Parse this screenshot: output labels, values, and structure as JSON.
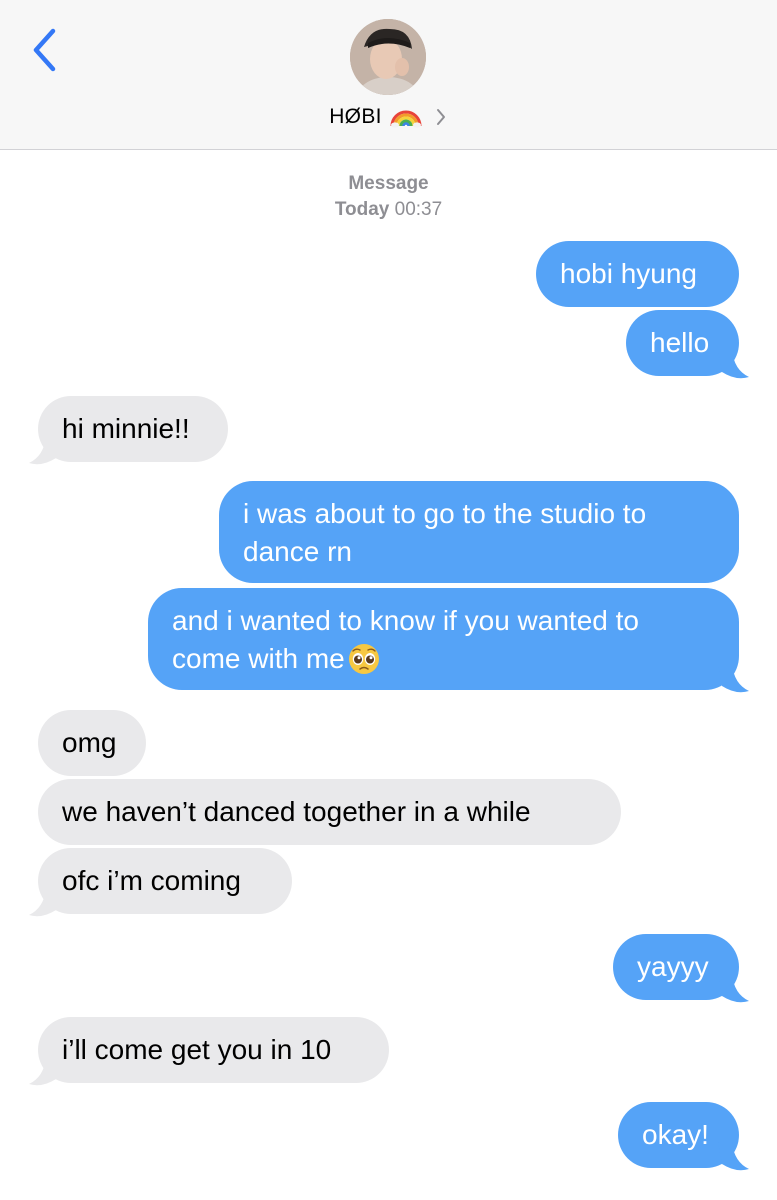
{
  "header": {
    "back_icon": "chevron-left-icon",
    "contact_name": "HØBI",
    "contact_emoji_icon": "rainbow-icon",
    "details_icon": "chevron-right-icon",
    "accent": "#3478f6"
  },
  "thread_meta": {
    "service": "Message",
    "day": "Today",
    "time": "00:37"
  },
  "colors": {
    "outgoing_bubble": "#55a3f7",
    "incoming_bubble": "#e9e9eb"
  },
  "messages": [
    {
      "direction": "outgoing",
      "text": "hobi hyung"
    },
    {
      "direction": "outgoing",
      "text": "hello"
    },
    {
      "direction": "incoming",
      "text": "hi minnie!!"
    },
    {
      "direction": "outgoing",
      "line1": "i was about to go to the studio to",
      "line2": "dance rn"
    },
    {
      "direction": "outgoing",
      "line1": "and i wanted to know if you wanted to",
      "line2": "come with me",
      "emoji_icon": "pleading-face-icon"
    },
    {
      "direction": "incoming",
      "text": "omg"
    },
    {
      "direction": "incoming",
      "text": "we haven’t danced together in a while"
    },
    {
      "direction": "incoming",
      "text": "ofc i’m coming"
    },
    {
      "direction": "outgoing",
      "text": "yayyy"
    },
    {
      "direction": "incoming",
      "text": "i’ll come get you in 10"
    },
    {
      "direction": "outgoing",
      "text": "okay!"
    }
  ]
}
